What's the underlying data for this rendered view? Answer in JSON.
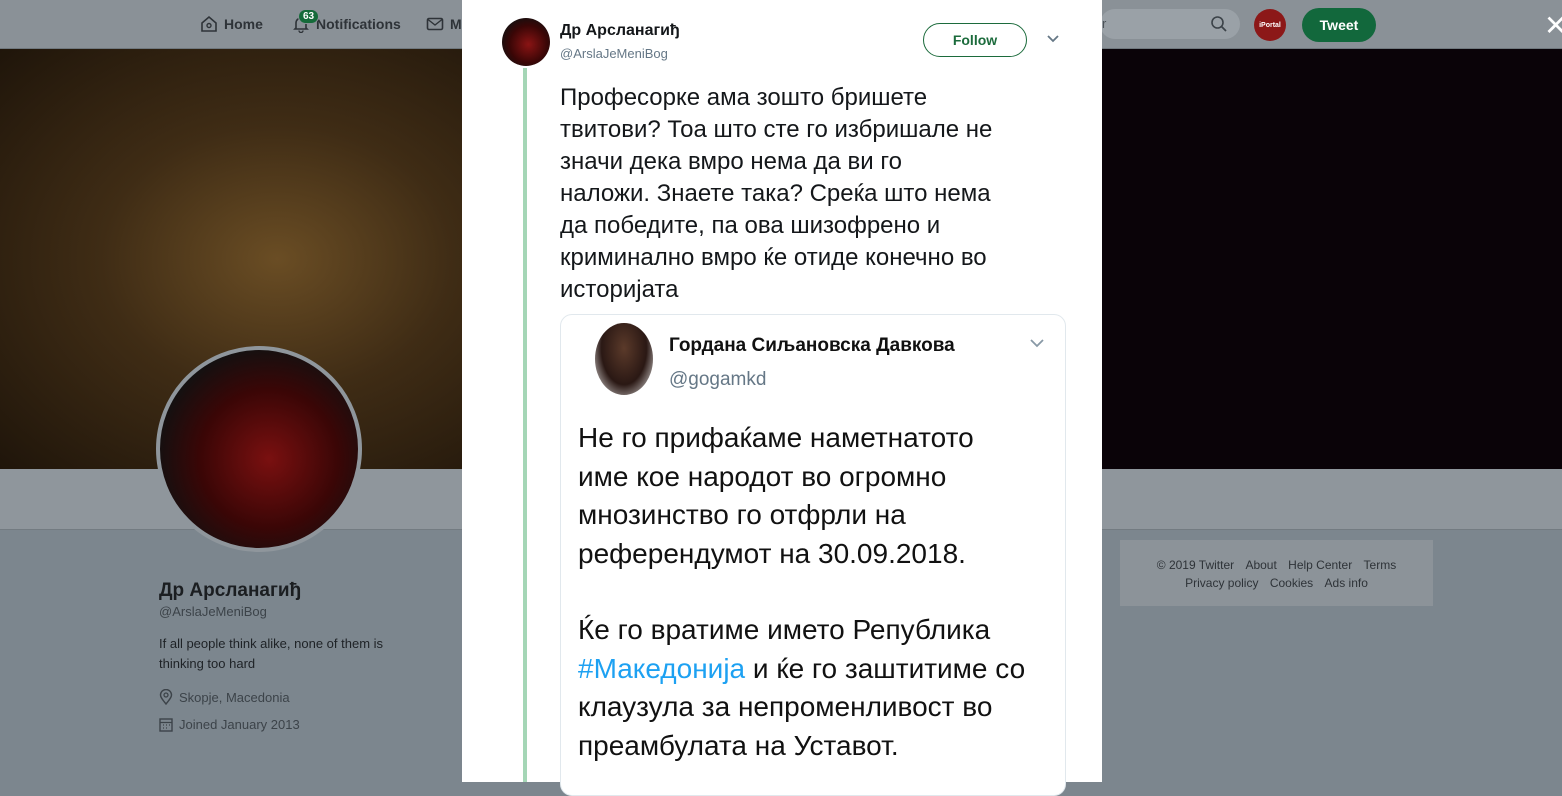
{
  "nav": {
    "home": "Home",
    "notifications": "Notifications",
    "notifications_count": "63",
    "messages": "M",
    "avatar_text": "iPortal",
    "tweet_button": "Tweet",
    "search_partial": "r"
  },
  "profile": {
    "name": "Др Арсланагиђ",
    "handle": "@ArslaJeMeniBog",
    "bio": "If all people think alike, none of them is thinking too hard",
    "location": "Skopje, Macedonia",
    "joined": "Joined January 2013"
  },
  "footer": {
    "row1": [
      "© 2019 Twitter",
      "About",
      "Help Center",
      "Terms"
    ],
    "row2": [
      "Privacy policy",
      "Cookies",
      "Ads info"
    ]
  },
  "modal": {
    "author_name": "Др Арсланагиђ",
    "author_handle": "@ArslaJeMeniBog",
    "follow_button": "Follow",
    "tweet_text": "Професорке ама зошто бришете\nтвитови? Тоа што сте го избришале не\nзначи дека вмро нема да ви го\nналожи. Знаете така? Среќа што нема\nда победите, па ова шизофрено и\nкриминално вмро ќе отиде конечно во\nисторијата",
    "embed": {
      "name": "Гордана Сиљановска Давкова",
      "handle": "@gogamkd",
      "text1": "Не го прифаќаме наметнатото\nиме кое народот во огромно\nмнозинство го отфрли на\nреферендумот на 30.09.2018.",
      "text2_before": "Ќе го вратиме името Република ",
      "hashtag": "#Македонија",
      "text2_after": " и ќе го заштитиме со клаузула за непроменливост во преамбулата на Уставот."
    }
  },
  "colors": {
    "accent_green": "#12683c",
    "thread_line": "#a5d6b6",
    "hashtag": "#1da1f2"
  }
}
